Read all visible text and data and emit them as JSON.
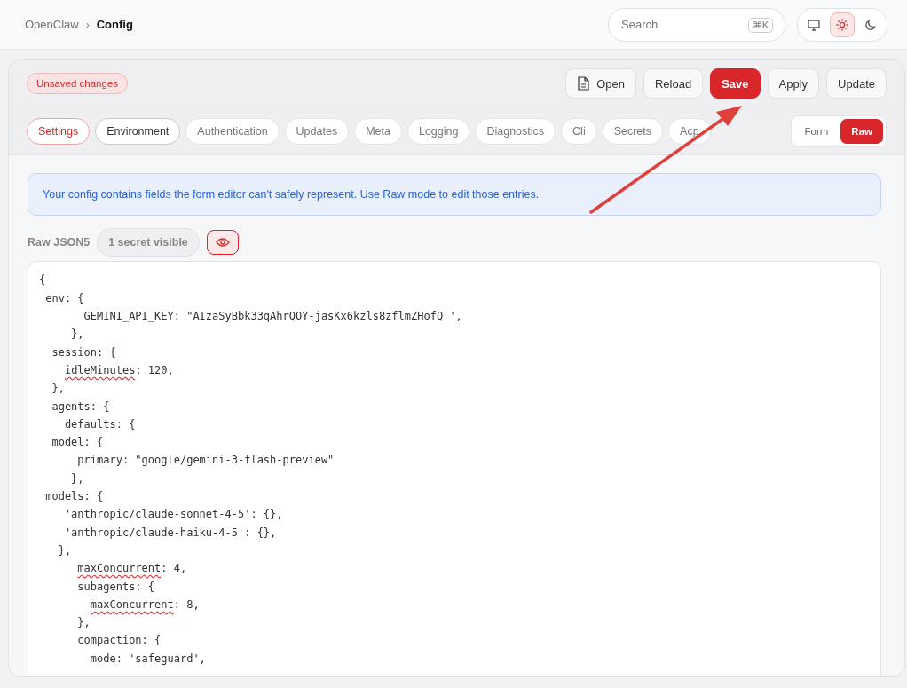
{
  "breadcrumb": {
    "parent": "OpenClaw",
    "separator": "›",
    "current": "Config"
  },
  "search": {
    "placeholder": "Search",
    "shortcut": "⌘K"
  },
  "theme_modes": [
    {
      "kind": "system",
      "selected": false
    },
    {
      "kind": "light",
      "selected": true
    },
    {
      "kind": "dark",
      "selected": false
    }
  ],
  "status_badge": "Unsaved changes",
  "actions": [
    {
      "label": "Open",
      "kind": "file",
      "primary": false
    },
    {
      "label": "Reload",
      "kind": "plain",
      "primary": false
    },
    {
      "label": "Save",
      "kind": "plain",
      "primary": true
    },
    {
      "label": "Apply",
      "kind": "plain",
      "primary": false
    },
    {
      "label": "Update",
      "kind": "plain",
      "primary": false
    }
  ],
  "tabs": [
    {
      "label": "Settings",
      "selected": true
    },
    {
      "label": "Environment",
      "selected": false
    },
    {
      "label": "Authentication",
      "selected": false
    },
    {
      "label": "Updates",
      "selected": false
    },
    {
      "label": "Meta",
      "selected": false
    },
    {
      "label": "Logging",
      "selected": false
    },
    {
      "label": "Diagnostics",
      "selected": false
    },
    {
      "label": "Cli",
      "selected": false
    },
    {
      "label": "Secrets",
      "selected": false
    },
    {
      "label": "Acp",
      "selected": false
    }
  ],
  "modes": [
    {
      "label": "Form",
      "selected": false
    },
    {
      "label": "Raw",
      "selected": true
    }
  ],
  "notice": "Your config contains fields the form editor can't safely represent. Use Raw mode to edit those entries.",
  "editor": {
    "label": "Raw JSON5",
    "secret_badge": "1 secret visible",
    "reveal_on": true,
    "lines": [
      {
        "text": "{",
        "misspelled": false
      },
      {
        "text": " env: {",
        "misspelled": false
      },
      {
        "text": "       GEMINI_API_KEY: \"AIzaSyBbk33qAhrQOY-jasKx6kzls8zflmZHofQ ',",
        "misspelled": false
      },
      {
        "text": "     },",
        "misspelled": false
      },
      {
        "text": "  session: {",
        "misspelled": false
      },
      {
        "text": "    idleMinutes: 120,",
        "misspelled": true
      },
      {
        "text": "  },",
        "misspelled": false
      },
      {
        "text": "  agents: {",
        "misspelled": false
      },
      {
        "text": "    defaults: {",
        "misspelled": false
      },
      {
        "text": "  model: {",
        "misspelled": false
      },
      {
        "text": "      primary: \"google/gemini-3-flash-preview\"",
        "misspelled": false
      },
      {
        "text": "     },",
        "misspelled": false
      },
      {
        "text": " models: {",
        "misspelled": false
      },
      {
        "text": "    'anthropic/claude-sonnet-4-5': {},",
        "misspelled": false
      },
      {
        "text": "    'anthropic/claude-haiku-4-5': {},",
        "misspelled": false
      },
      {
        "text": "   },",
        "misspelled": false
      },
      {
        "text": "      maxConcurrent: 4,",
        "misspelled": true
      },
      {
        "text": "      subagents: {",
        "misspelled": false
      },
      {
        "text": "        maxConcurrent: 8,",
        "misspelled": true
      },
      {
        "text": "      },",
        "misspelled": false
      },
      {
        "text": "      compaction: {",
        "misspelled": false
      },
      {
        "text": "        mode: 'safeguard',",
        "misspelled": false
      }
    ]
  }
}
